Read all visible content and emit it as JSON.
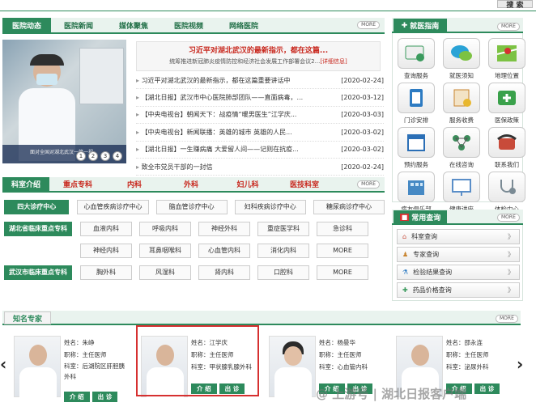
{
  "top": {
    "search_label": "搜 索"
  },
  "news": {
    "tabs": [
      "医院动态",
      "医院新闻",
      "媒体聚焦",
      "医院视频",
      "网络医院"
    ],
    "more": "MORE",
    "headline": "习近平对湖北武汉的最新指示，都在这篇...",
    "summary": "统筹推进新冠肺炎疫情防控和经济社会发展工作部署会议2...",
    "detail_link": "[详细信息]",
    "slider_pages": [
      "1",
      "2",
      "3",
      "4"
    ],
    "video_caption": "面对全国对湖北武汉一笑一视",
    "items": [
      {
        "title": "习近平对湖北武汉的最新指示，都在这篇重要讲话中",
        "date": "[2020-02-24]"
      },
      {
        "title": "【湖北日报】武汉市中心医院肺部团队——直面病毒，...",
        "date": "[2020-03-12]"
      },
      {
        "title": "【中央电视台】朝闻天下：战疫情“暖男医生”江学庆...",
        "date": "[2020-03-03]"
      },
      {
        "title": "【中央电视台】新闻联播：英雄的城市 英雄的人民...",
        "date": "[2020-03-02]"
      },
      {
        "title": "【湖北日报】一生赚病痛 大爱留人间——记则在抗疫...",
        "date": "[2020-03-02]"
      },
      {
        "title": "致全市党员干部的一封信",
        "date": "[2020-02-24]"
      }
    ]
  },
  "dept": {
    "tabs": [
      "科室介绍",
      "重点专科",
      "内科",
      "外科",
      "妇儿科",
      "医技科室"
    ],
    "more": "MORE",
    "rows": [
      {
        "label": "四大诊疗中心",
        "items": [
          "心血管疾病诊疗中心",
          "脑血管诊疗中心",
          "妇科疾病诊疗中心",
          "糖尿病诊疗中心"
        ]
      },
      {
        "label": "湖北省临床重点专科",
        "items": [
          "血液内科",
          "呼吸内科",
          "神经外科",
          "重症医学科",
          "急诊科"
        ]
      },
      {
        "label": "",
        "items": [
          "神经内科",
          "耳鼻咽喉科",
          "心血管内科",
          "消化内科",
          "MORE"
        ]
      },
      {
        "label": "武汉市临床重点专科",
        "items": [
          "胸外科",
          "风湿科",
          "肾内科",
          "口腔科",
          "MORE"
        ]
      }
    ]
  },
  "guide": {
    "title": "就医指南",
    "more": "MORE",
    "items": [
      {
        "label": "查询服务",
        "icon": "query-icon",
        "color": "#3a9a5d"
      },
      {
        "label": "就医须知",
        "icon": "notice-bubble-icon",
        "color": "#2aa3d6"
      },
      {
        "label": "地理位置",
        "icon": "map-icon",
        "color": "#4a9e3c"
      },
      {
        "label": "门诊安排",
        "icon": "clipboard-icon",
        "color": "#2d7bc2"
      },
      {
        "label": "服务收费",
        "icon": "receipt-icon",
        "color": "#c8842f"
      },
      {
        "label": "医保政策",
        "icon": "medical-cross-icon",
        "color": "#3aa14b"
      },
      {
        "label": "预约服务",
        "icon": "calendar-icon",
        "color": "#2b6fb6"
      },
      {
        "label": "在线咨询",
        "icon": "chat-network-icon",
        "color": "#3b8c5a"
      },
      {
        "label": "联系我们",
        "icon": "phone-icon",
        "color": "#c84b3a"
      },
      {
        "label": "病友俱乐部",
        "icon": "building-icon",
        "color": "#4689c4"
      },
      {
        "label": "健康讲座",
        "icon": "lecture-icon",
        "color": "#5a8ec8"
      },
      {
        "label": "体检中心",
        "icon": "stethoscope-icon",
        "color": "#7a8a94"
      }
    ]
  },
  "query": {
    "title": "常用查询",
    "more": "MORE",
    "items": [
      {
        "label": "科室查询",
        "icon": "hospital-icon"
      },
      {
        "label": "专家查询",
        "icon": "doctor-icon"
      },
      {
        "label": "检验结果查询",
        "icon": "test-tube-icon"
      },
      {
        "label": "药品价格查询",
        "icon": "pill-icon"
      }
    ],
    "arrow": "》"
  },
  "experts": {
    "title": "知名专家",
    "more": "MORE",
    "field_name": "姓名：",
    "field_title": "职称：",
    "field_dept": "科室：",
    "intro_btn": "介 绍",
    "schedule_btn": "出 诊",
    "list": [
      {
        "name": "朱峥",
        "title": "主任医师",
        "dept": "后湖院区肝胆胰外科"
      },
      {
        "name": "江学庆",
        "title": "主任医师",
        "dept": "甲状腺乳腺外科"
      },
      {
        "name": "杨曼华",
        "title": "主任医师",
        "dept": "心血管内科"
      },
      {
        "name": "邵永连",
        "title": "主任医师",
        "dept": "泌尿外科"
      }
    ],
    "prev": "‹",
    "next": "›"
  },
  "watermark": "@ 上游号 | 湖北日报客户端",
  "colors": {
    "brand": "#2d8a5c",
    "highlight": "#d63030",
    "headline": "#c8281e"
  }
}
